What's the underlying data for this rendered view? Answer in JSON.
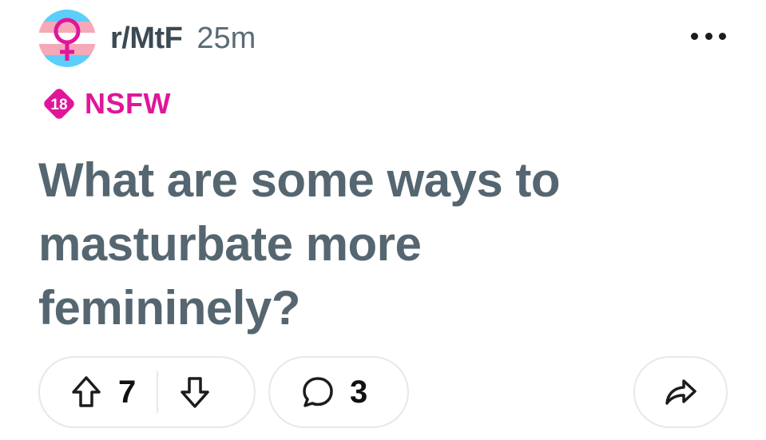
{
  "post": {
    "subreddit": "r/MtF",
    "time_ago": "25m",
    "nsfw_badge_number": "18",
    "nsfw_label": "NSFW",
    "title": "What are some ways to masturbate more femininely?",
    "upvotes": "7",
    "comments": "3"
  },
  "icons": {
    "avatar": "transgender-flag-female-symbol-icon",
    "more": "more-options-icon",
    "upvote": "upvote-arrow-icon",
    "downvote": "downvote-arrow-icon",
    "comment": "comment-bubble-icon",
    "share": "share-arrow-icon"
  },
  "colors": {
    "nsfw": "#e0169a",
    "title": "#556670",
    "trans_blue": "#5bcefa",
    "trans_pink": "#f5a9b8",
    "female_symbol": "#e0169a"
  }
}
